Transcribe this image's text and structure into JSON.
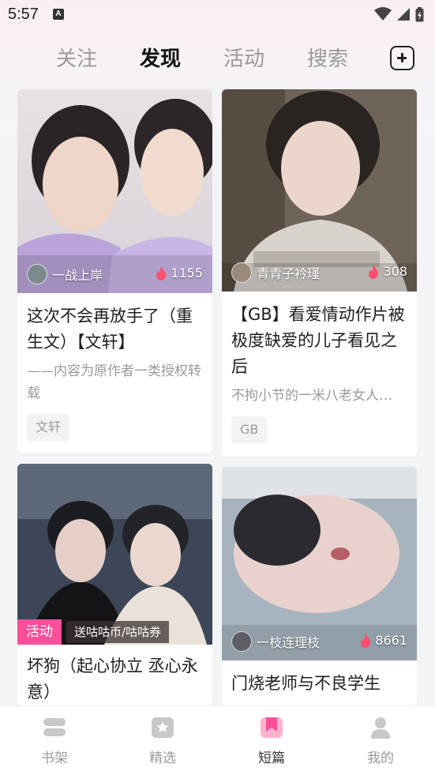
{
  "status_bar": {
    "time": "5:57",
    "notification_icon": "a-icon",
    "wifi_icon": "wifi-icon",
    "signal_icon": "signal-icon",
    "battery_icon": "battery-charging-icon"
  },
  "top_tabs": [
    {
      "label": "关注",
      "active": false
    },
    {
      "label": "发现",
      "active": true
    },
    {
      "label": "活动",
      "active": false
    },
    {
      "label": "搜索",
      "active": false
    }
  ],
  "add_button_icon": "plus-square-icon",
  "cards": [
    {
      "author": "一战上岸",
      "heat": "1155",
      "title": "这次不会再放手了（重生文）【文轩】",
      "description": "——内容为原作者一类授权转载",
      "tag": "文轩"
    },
    {
      "author": "青青子衿瑾",
      "heat": "308",
      "title": "【GB】看爱情动作片被极度缺爱的儿子看见之后",
      "description": "不拘小节的一米八老女人…",
      "tag": "GB"
    },
    {
      "promo_label": "活动",
      "promo_text": "送咕咕币/咕咕券",
      "title": "坏狗（起心协立 丞心永意）"
    },
    {
      "author": "一枝连理枝",
      "heat": "8661",
      "title": "门烧老师与不良学生"
    }
  ],
  "bottom_nav": [
    {
      "label": "书架",
      "icon": "bookshelf-icon",
      "active": false
    },
    {
      "label": "精选",
      "icon": "star-badge-icon",
      "active": false
    },
    {
      "label": "短篇",
      "icon": "bookmark-icon",
      "active": true
    },
    {
      "label": "我的",
      "icon": "person-icon",
      "active": false
    }
  ],
  "colors": {
    "accent_pink": "#ff4f9a",
    "heat_flame": "#ff4d6d",
    "inactive_text": "#9a9a9a"
  }
}
